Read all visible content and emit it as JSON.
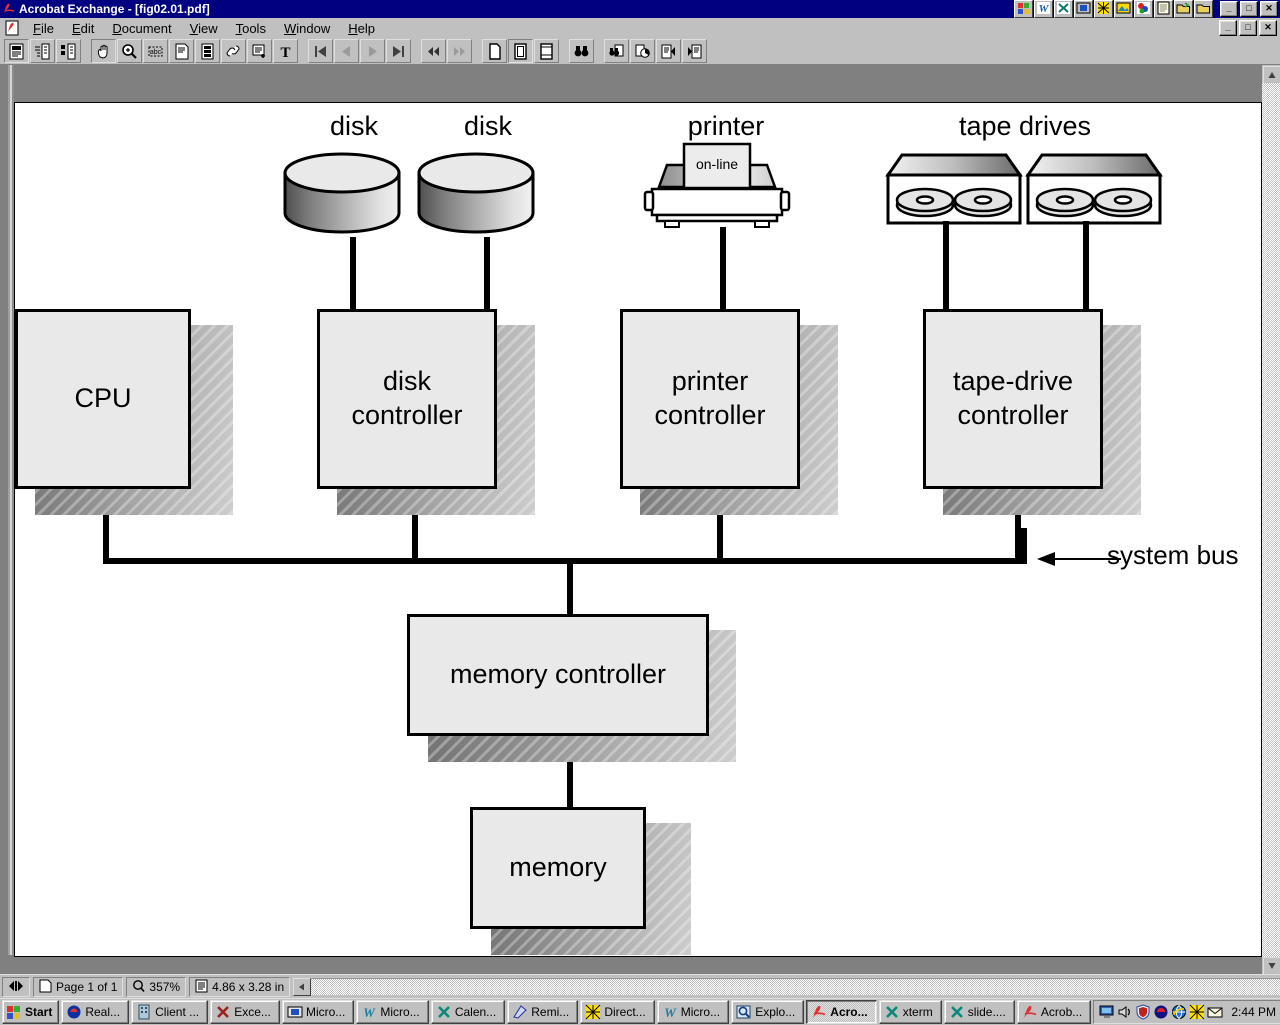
{
  "window": {
    "title": "Acrobat Exchange - [fig02.01.pdf]",
    "title_icon": "acrobat-icon",
    "minimize_label": "_",
    "maximize_label": "□",
    "close_label": "✕",
    "mdi_minimize_label": "_",
    "mdi_restore_label": "□",
    "mdi_close_label": "✕"
  },
  "quick_launch": [
    {
      "name": "windows-start-icon",
      "glyph": "■"
    },
    {
      "name": "word-icon",
      "glyph": "W"
    },
    {
      "name": "excel-icon",
      "glyph": "X"
    },
    {
      "name": "powerpoint-icon",
      "glyph": "▣"
    },
    {
      "name": "network-icon",
      "glyph": "✳"
    },
    {
      "name": "photo-icon",
      "glyph": "▤"
    },
    {
      "name": "paint-icon",
      "glyph": "✿"
    },
    {
      "name": "notepad-icon",
      "glyph": "☰"
    },
    {
      "name": "open-folder-icon",
      "glyph": "⤧"
    },
    {
      "name": "folder-icon",
      "glyph": "▰"
    }
  ],
  "menu": {
    "doc_icon": "document-icon",
    "items": [
      {
        "label": "File",
        "mnemonic": "F"
      },
      {
        "label": "Edit",
        "mnemonic": "E"
      },
      {
        "label": "Document",
        "mnemonic": "D"
      },
      {
        "label": "View",
        "mnemonic": "V"
      },
      {
        "label": "Tools",
        "mnemonic": "T"
      },
      {
        "label": "Window",
        "mnemonic": "W"
      },
      {
        "label": "Help",
        "mnemonic": "H"
      }
    ]
  },
  "toolbar": {
    "groups": [
      {
        "buttons": [
          {
            "name": "page-only-view-button",
            "icon": "page-only-icon",
            "pressed": true
          },
          {
            "name": "bookmarks-view-button",
            "icon": "bookmarks-icon",
            "pressed": false
          },
          {
            "name": "thumbnails-view-button",
            "icon": "thumbnails-icon",
            "pressed": false
          }
        ]
      },
      {
        "buttons": [
          {
            "name": "hand-tool-button",
            "icon": "hand-icon",
            "pressed": true
          },
          {
            "name": "zoom-tool-button",
            "icon": "magnifier-icon",
            "pressed": false
          },
          {
            "name": "select-text-button",
            "icon": "select-text-icon",
            "pressed": false
          },
          {
            "name": "notes-tool-button",
            "icon": "note-icon",
            "pressed": false
          },
          {
            "name": "movie-tool-button",
            "icon": "film-icon",
            "pressed": false
          },
          {
            "name": "link-tool-button",
            "icon": "link-icon",
            "pressed": false
          },
          {
            "name": "article-tool-button",
            "icon": "article-icon",
            "pressed": false
          },
          {
            "name": "text-tool-button",
            "icon": "text-icon",
            "pressed": false
          }
        ]
      },
      {
        "buttons": [
          {
            "name": "first-page-button",
            "icon": "first-page-icon",
            "pressed": false
          },
          {
            "name": "previous-page-button",
            "icon": "previous-page-icon",
            "pressed": false
          },
          {
            "name": "next-page-button",
            "icon": "next-page-icon",
            "pressed": false
          },
          {
            "name": "last-page-button",
            "icon": "last-page-icon",
            "pressed": false
          }
        ]
      },
      {
        "buttons": [
          {
            "name": "go-back-button",
            "icon": "rewind-icon",
            "pressed": false
          },
          {
            "name": "go-forward-button",
            "icon": "fast-forward-icon",
            "pressed": false
          }
        ]
      },
      {
        "buttons": [
          {
            "name": "actual-size-button",
            "icon": "actual-size-icon",
            "pressed": false
          },
          {
            "name": "fit-page-button",
            "icon": "fit-page-icon",
            "pressed": true
          },
          {
            "name": "fit-width-button",
            "icon": "fit-width-icon",
            "pressed": false
          }
        ]
      },
      {
        "buttons": [
          {
            "name": "find-button",
            "icon": "binoculars-icon",
            "pressed": false
          }
        ]
      },
      {
        "buttons": [
          {
            "name": "search-button",
            "icon": "search-docs-icon",
            "pressed": false
          },
          {
            "name": "search-results-button",
            "icon": "search-results-icon",
            "pressed": false
          },
          {
            "name": "previous-highlight-button",
            "icon": "previous-highlight-icon",
            "pressed": false
          },
          {
            "name": "next-highlight-button",
            "icon": "next-highlight-icon",
            "pressed": false
          }
        ]
      }
    ]
  },
  "status_bar": {
    "page_nav_icon": "page-nav-icon",
    "page_icon": "page-icon",
    "page_label": "Page 1 of 1",
    "zoom_icon": "magnifier-icon",
    "zoom_label": "357%",
    "size_icon": "page-size-icon",
    "size_label": "4.86 x 3.28 in"
  },
  "taskbar": {
    "start_label": "Start",
    "start_icon": "windows-logo-icon",
    "buttons": [
      {
        "label": "Real...",
        "icon": "realplayer-icon",
        "active": false
      },
      {
        "label": "Client ...",
        "icon": "client-icon",
        "active": false
      },
      {
        "label": "Exce...",
        "icon": "excel-icon",
        "active": false
      },
      {
        "label": "Micro...",
        "icon": "powerpoint-icon",
        "active": false
      },
      {
        "label": "Micro...",
        "icon": "word-icon",
        "active": false
      },
      {
        "label": "Calen...",
        "icon": "excel-icon",
        "active": false
      },
      {
        "label": "Remi...",
        "icon": "reminder-icon",
        "active": false
      },
      {
        "label": "Direct...",
        "icon": "directory-icon",
        "active": false
      },
      {
        "label": "Micro...",
        "icon": "word-icon",
        "active": false
      },
      {
        "label": "Explo...",
        "icon": "explorer-icon",
        "active": false
      },
      {
        "label": "Acro...",
        "icon": "acrobat-icon",
        "active": true
      },
      {
        "label": "xterm",
        "icon": "xterm-icon",
        "active": false
      },
      {
        "label": "slide....",
        "icon": "xterm-icon",
        "active": false
      },
      {
        "label": "Acrob...",
        "icon": "acrobat-icon",
        "active": false
      }
    ],
    "tray_icons": [
      {
        "name": "display-icon"
      },
      {
        "name": "volume-icon"
      },
      {
        "name": "antivirus-shield-icon"
      },
      {
        "name": "realplayer-tray-icon"
      },
      {
        "name": "explorer-globe-icon"
      },
      {
        "name": "network-tray-icon"
      },
      {
        "name": "mail-icon"
      }
    ],
    "clock": "2:44 PM"
  },
  "diagram": {
    "device_labels": [
      {
        "name": "disk-label-1",
        "text": "disk"
      },
      {
        "name": "disk-label-2",
        "text": "disk"
      },
      {
        "name": "printer-label",
        "text": "printer"
      },
      {
        "name": "tape-drives-label",
        "text": "tape drives"
      }
    ],
    "printer_status": "on-line",
    "boxes": [
      {
        "name": "cpu-box",
        "lines": [
          "CPU"
        ]
      },
      {
        "name": "disk-controller-box",
        "lines": [
          "disk",
          "controller"
        ]
      },
      {
        "name": "printer-controller-box",
        "lines": [
          "printer",
          "controller"
        ]
      },
      {
        "name": "tape-drive-controller-box",
        "lines": [
          "tape-drive",
          "controller"
        ]
      },
      {
        "name": "memory-controller-box",
        "lines": [
          "memory controller"
        ]
      },
      {
        "name": "memory-box",
        "lines": [
          "memory"
        ]
      }
    ],
    "bus_label": "system bus",
    "colors": {
      "box_fill": "#e9e9e9",
      "box_stroke": "#000000",
      "page_bg": "#ffffff",
      "desktop": "#808080",
      "chrome": "#c0c0c0",
      "title_bar": "#000080"
    }
  }
}
